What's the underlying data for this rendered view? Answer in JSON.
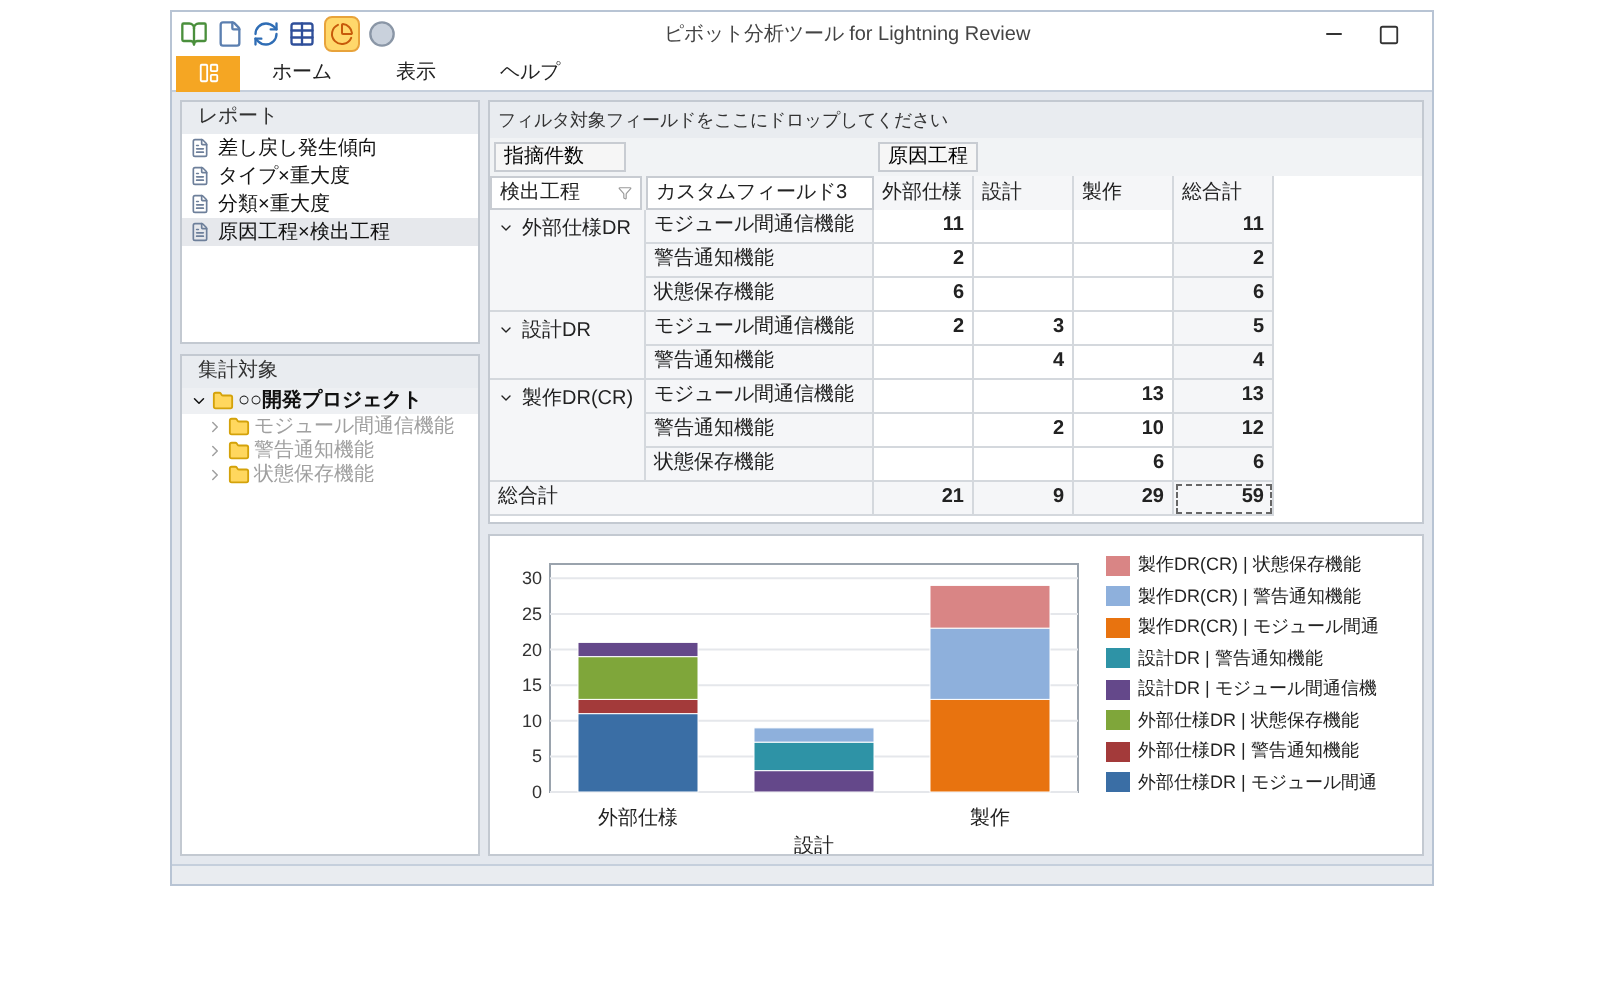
{
  "window": {
    "title": "ピボット分析ツール for Lightning Review"
  },
  "ribbon": {
    "tabs": [
      {
        "label": "ホーム"
      },
      {
        "label": "表示"
      },
      {
        "label": "ヘルプ"
      }
    ]
  },
  "reports": {
    "title": "レポート",
    "items": [
      {
        "label": "差し戻し発生傾向",
        "selected": false
      },
      {
        "label": "タイプ×重大度",
        "selected": false
      },
      {
        "label": "分類×重大度",
        "selected": false
      },
      {
        "label": "原因工程×検出工程",
        "selected": true
      }
    ]
  },
  "summary_target": {
    "title": "集計対象",
    "tree": [
      {
        "label": "○○開発プロジェクト",
        "expanded": true,
        "disabled": false,
        "children": [
          {
            "label": "モジュール間通信機能",
            "expanded": false,
            "disabled": true
          },
          {
            "label": "警告通知機能",
            "expanded": false,
            "disabled": true
          },
          {
            "label": "状態保存機能",
            "expanded": false,
            "disabled": true
          }
        ]
      }
    ]
  },
  "pivot": {
    "filter_hint": "フィルタ対象フィールドをここにドロップしてください",
    "data_field": "指摘件数",
    "column_field": "原因工程",
    "row_fields": [
      "検出工程",
      "カスタムフィールド3"
    ],
    "columns": [
      "外部仕様",
      "設計",
      "製作",
      "総合計"
    ],
    "groups": [
      {
        "label": "外部仕様DR",
        "expanded": true,
        "rows": [
          {
            "label": "モジュール間通信機能",
            "col_0": "11",
            "col_3": "11"
          },
          {
            "label": "警告通知機能",
            "col_0": "2",
            "col_3": "2"
          },
          {
            "label": "状態保存機能",
            "col_0": "6",
            "col_3": "6"
          }
        ]
      },
      {
        "label": "設計DR",
        "expanded": true,
        "rows": [
          {
            "label": "モジュール間通信機能",
            "col_0": "2",
            "col_1": "3",
            "col_3": "5"
          },
          {
            "label": "警告通知機能",
            "col_1": "4",
            "col_3": "4"
          }
        ]
      },
      {
        "label": "製作DR(CR)",
        "expanded": true,
        "rows": [
          {
            "label": "モジュール間通信機能",
            "col_2": "13",
            "col_3": "13"
          },
          {
            "label": "警告通知機能",
            "col_1": "2",
            "col_2": "10",
            "col_3": "12"
          },
          {
            "label": "状態保存機能",
            "col_2": "6",
            "col_3": "6"
          }
        ]
      }
    ],
    "grand_total": {
      "label": "総合計",
      "col_0": "21",
      "col_1": "9",
      "col_2": "29",
      "col_3": "59"
    }
  },
  "chart": {
    "chart_data": {
      "type": "bar",
      "stacked": true,
      "grid": true,
      "categories": [
        "外部仕様",
        "設計",
        "製作"
      ],
      "ylim": [
        0,
        32
      ],
      "yticks": [
        0,
        5,
        10,
        15,
        20,
        25,
        30
      ],
      "series": [
        {
          "name": "外部仕様DR | モジュール間通",
          "color": "#3a6ea5",
          "values": [
            11,
            null,
            null
          ]
        },
        {
          "name": "外部仕様DR | 警告通知機能",
          "color": "#a33a3a",
          "values": [
            2,
            null,
            null
          ]
        },
        {
          "name": "外部仕様DR | 状態保存機能",
          "color": "#7fa63a",
          "values": [
            6,
            null,
            null
          ]
        },
        {
          "name": "設計DR | モジュール間通信機",
          "color": "#64488a",
          "values": [
            2,
            3,
            null
          ]
        },
        {
          "name": "設計DR | 警告通知機能",
          "color": "#2e93a6",
          "values": [
            null,
            4,
            null
          ]
        },
        {
          "name": "製作DR(CR) | モジュール間通",
          "color": "#e8730f",
          "values": [
            null,
            null,
            13
          ]
        },
        {
          "name": "製作DR(CR) | 警告通知機能",
          "color": "#8eb0dc",
          "values": [
            null,
            2,
            10
          ]
        },
        {
          "name": "製作DR(CR) | 状態保存機能",
          "color": "#d98585",
          "values": [
            null,
            null,
            6
          ]
        }
      ]
    }
  }
}
